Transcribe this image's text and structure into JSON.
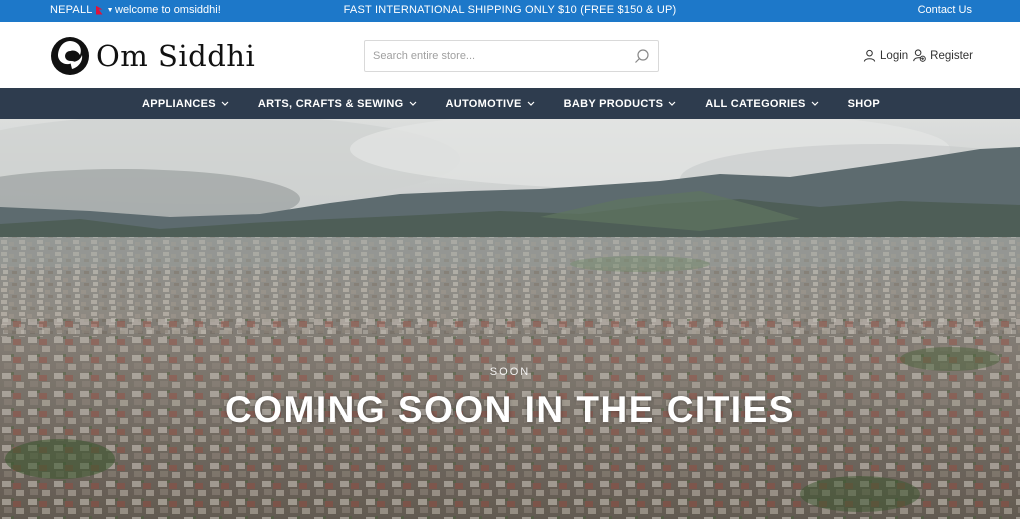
{
  "topbar": {
    "country": "NEPALL",
    "welcome": "welcome to omsiddhi!",
    "shipping": "FAST INTERNATIONAL SHIPPING ONLY $10 (FREE $150 & UP)",
    "contact": "Contact Us"
  },
  "header": {
    "logo_text": "Om Siddhi",
    "search_placeholder": "Search entire store...",
    "login": "Login",
    "register": "Register"
  },
  "nav": {
    "items": [
      {
        "label": "APPLIANCES",
        "has_dropdown": true
      },
      {
        "label": "ARTS, CRAFTS & SEWING",
        "has_dropdown": true
      },
      {
        "label": "AUTOMOTIVE",
        "has_dropdown": true
      },
      {
        "label": "BABY PRODUCTS",
        "has_dropdown": true
      },
      {
        "label": "ALL CATEGORIES",
        "has_dropdown": true
      },
      {
        "label": "SHOP",
        "has_dropdown": false
      }
    ]
  },
  "hero": {
    "kicker": "SOON",
    "headline": "COMING SOON IN THE CITIES"
  },
  "colors": {
    "topbar": "#1d78c9",
    "nav": "#2e3c4e"
  }
}
